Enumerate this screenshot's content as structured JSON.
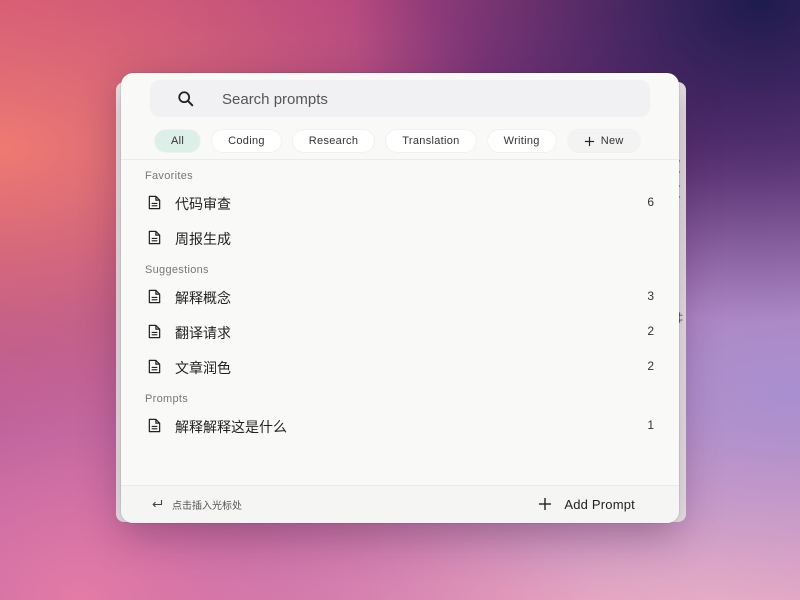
{
  "search": {
    "placeholder": "Search prompts",
    "icon": "search-icon"
  },
  "filters": [
    {
      "label": "All",
      "active": true
    },
    {
      "label": "Coding",
      "active": false
    },
    {
      "label": "Research",
      "active": false
    },
    {
      "label": "Translation",
      "active": false
    },
    {
      "label": "Writing",
      "active": false
    }
  ],
  "new_filter_label": "New",
  "sections": {
    "favorites": {
      "title": "Favorites",
      "items": [
        {
          "label": "代码审查",
          "count": "6"
        },
        {
          "label": "周报生成",
          "count": ""
        }
      ]
    },
    "suggestions": {
      "title": "Suggestions",
      "items": [
        {
          "label": "解释概念",
          "count": "3"
        },
        {
          "label": "翻译请求",
          "count": "2"
        },
        {
          "label": "文章润色",
          "count": "2"
        }
      ]
    },
    "prompts": {
      "title": "Prompts",
      "items": [
        {
          "label": "解释解释这是什么",
          "count": "1"
        }
      ]
    }
  },
  "footer": {
    "hint": "点击插入光标处",
    "add_label": "Add Prompt"
  },
  "colors": {
    "active_chip": "#dcefe8",
    "panel_bg": "#f9f9f8",
    "search_bg": "#f1f1f3"
  }
}
